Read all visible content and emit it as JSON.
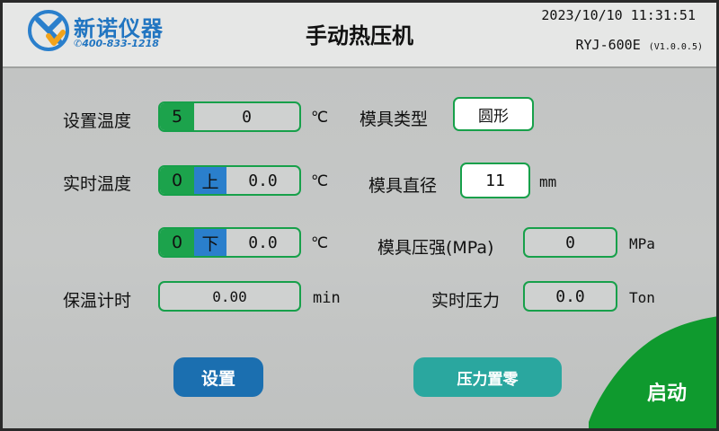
{
  "header": {
    "logo_name": "新诺仪器",
    "logo_phone": "400-833-1218",
    "title": "手动热压机",
    "datetime": "2023/10/10  11:31:51",
    "model": "RYJ-600E",
    "version": "(V1.0.0.5)"
  },
  "temperature": {
    "set_label": "设置温度",
    "set_index": "5",
    "set_value": "0",
    "unit": "℃",
    "real_label": "实时温度",
    "upper_index": "0",
    "upper_tag": "上",
    "upper_value": "0.0",
    "lower_index": "0",
    "lower_tag": "下",
    "lower_value": "0.0"
  },
  "hold": {
    "label": "保温计时",
    "value": "0.00",
    "unit": "min"
  },
  "mold": {
    "type_label": "模具类型",
    "type_value": "圆形",
    "diameter_label": "模具直径",
    "diameter_value": "11",
    "diameter_unit": "mm",
    "pressure_label": "模具压强(MPa)",
    "pressure_value": "0",
    "pressure_unit": "MPa",
    "force_label": "实时压力",
    "force_value": "0.0",
    "force_unit": "Ton"
  },
  "buttons": {
    "set": "设置",
    "zero": "压力置零",
    "start": "启动"
  },
  "colors": {
    "green": "#1ca34c",
    "blue": "#2a7fcc",
    "set_button": "#1b6fb0",
    "zero_button": "#2aa79f",
    "start_button": "#0f9a2e"
  }
}
